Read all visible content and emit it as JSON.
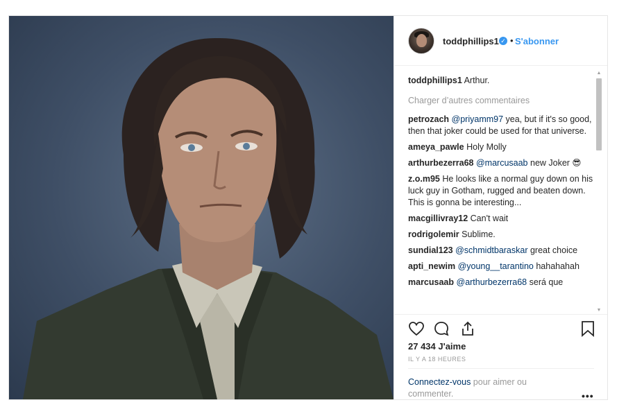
{
  "post": {
    "username": "toddphillips1",
    "separator": "•",
    "follow_label": "S'abonner",
    "caption": {
      "user": "toddphillips1",
      "text": "Arthur."
    },
    "load_more_label": "Charger d’autres commentaires",
    "comments": [
      {
        "user": "petrozach",
        "mention": "@priyamm97",
        "text": " yea, but if it's so good, then that joker could be used for that universe."
      },
      {
        "user": "ameya_pawle",
        "mention": "",
        "text": "Holy Molly"
      },
      {
        "user": "arthurbezerra68",
        "mention": "@marcusaab",
        "text": " new Joker 😎"
      },
      {
        "user": "z.o.m95",
        "mention": "",
        "text": "He looks like a normal guy down on his luck guy in Gotham, rugged and beaten down. This is gonna be interesting..."
      },
      {
        "user": "macgillivray12",
        "mention": "",
        "text": "Can't wait"
      },
      {
        "user": "rodrigolemir",
        "mention": "",
        "text": "Sublime."
      },
      {
        "user": "sundial123",
        "mention": "@schmidtbaraskar",
        "text": " great choice"
      },
      {
        "user": "apti_newim",
        "mention": "@young__tarantino",
        "text": " hahahahah"
      },
      {
        "user": "marcusaab",
        "mention": "@arthurbezerra68",
        "text": " será que"
      }
    ],
    "likes": "27 434 J'aime",
    "timestamp": "IL Y A 18 HEURES",
    "login_link": "Connectez-vous",
    "login_rest": " pour aimer ou commenter.",
    "more_label": "•••"
  },
  "icons": {
    "verified": "verified-badge-icon",
    "like": "heart-icon",
    "comment": "comment-bubble-icon",
    "share": "share-icon",
    "save": "bookmark-icon"
  },
  "colors": {
    "accent": "#3897f0",
    "mention": "#003569",
    "muted": "#999999"
  }
}
